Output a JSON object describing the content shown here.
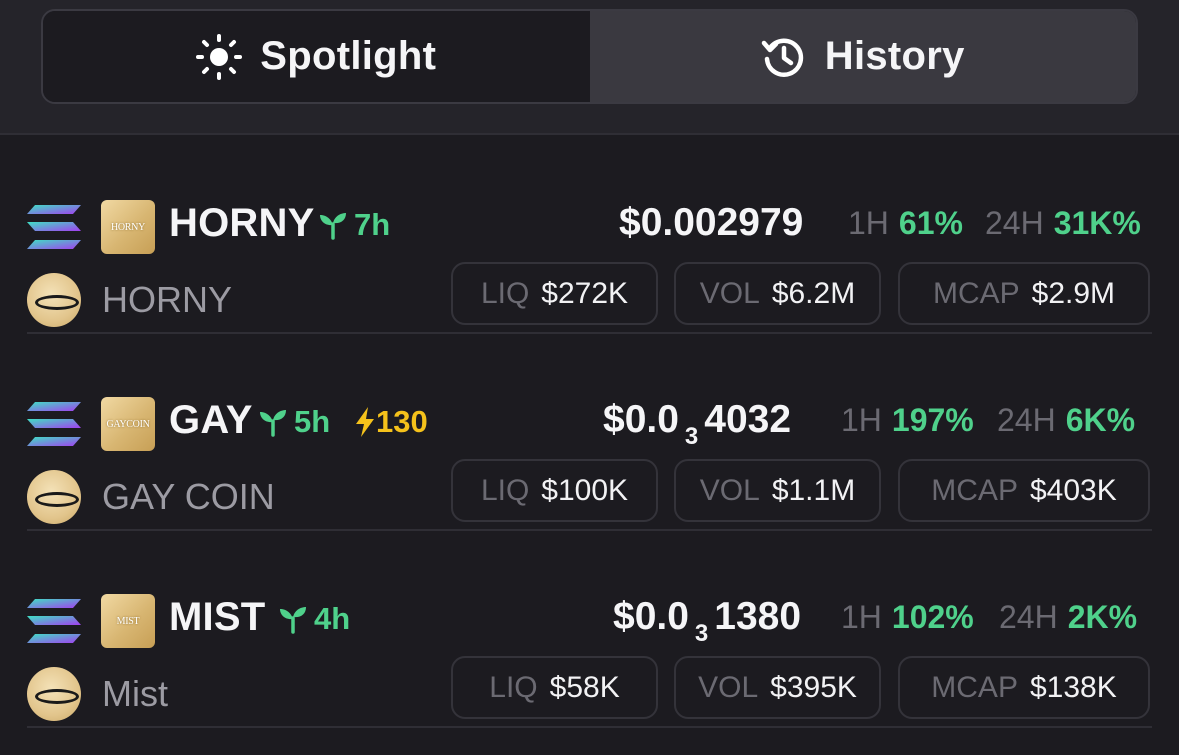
{
  "tabs": [
    {
      "label": "Spotlight",
      "icon": "sun-icon",
      "active": true
    },
    {
      "label": "History",
      "icon": "history-icon",
      "active": false
    }
  ],
  "colors": {
    "positive": "#4fd18b",
    "boost": "#f5c21b",
    "background": "#1c1b20"
  },
  "tokens": [
    {
      "symbol": "HORNY",
      "image_text": "HORNY",
      "name": "HORNY",
      "age": "7h",
      "boost": null,
      "price": {
        "main": "$0.002979",
        "sub": null,
        "tail": null
      },
      "change_1h": {
        "label": "1H",
        "value": "61%"
      },
      "change_24h": {
        "label": "24H",
        "value": "31K%"
      },
      "liq": {
        "label": "LIQ",
        "value": "$272K"
      },
      "vol": {
        "label": "VOL",
        "value": "$6.2M"
      },
      "mcap": {
        "label": "MCAP",
        "value": "$2.9M"
      }
    },
    {
      "symbol": "GAY",
      "image_text": "GAYCOIN",
      "name": "GAY COIN",
      "age": "5h",
      "boost": "130",
      "price": {
        "main": "$0.0",
        "sub": "3",
        "tail": "4032"
      },
      "change_1h": {
        "label": "1H",
        "value": "197%"
      },
      "change_24h": {
        "label": "24H",
        "value": "6K%"
      },
      "liq": {
        "label": "LIQ",
        "value": "$100K"
      },
      "vol": {
        "label": "VOL",
        "value": "$1.1M"
      },
      "mcap": {
        "label": "MCAP",
        "value": "$403K"
      }
    },
    {
      "symbol": "MIST",
      "image_text": "MIST",
      "name": "Mist",
      "age": "4h",
      "boost": null,
      "price": {
        "main": "$0.0",
        "sub": "3",
        "tail": "1380"
      },
      "change_1h": {
        "label": "1H",
        "value": "102%"
      },
      "change_24h": {
        "label": "24H",
        "value": "2K%"
      },
      "liq": {
        "label": "LIQ",
        "value": "$58K"
      },
      "vol": {
        "label": "VOL",
        "value": "$395K"
      },
      "mcap": {
        "label": "MCAP",
        "value": "$138K"
      }
    }
  ]
}
